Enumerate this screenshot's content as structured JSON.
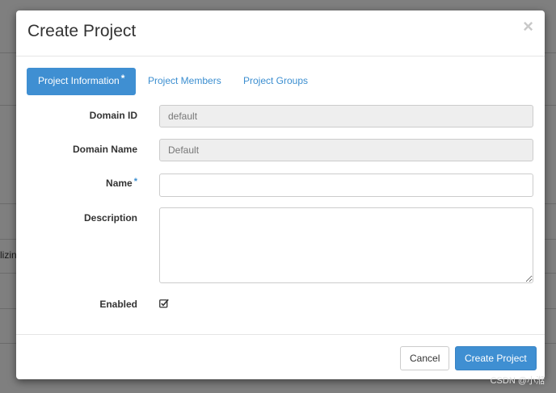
{
  "background": {
    "partial_text": "lizin"
  },
  "modal": {
    "title": "Create Project",
    "close_symbol": "×",
    "tabs": [
      {
        "label": "Project Information",
        "required_mark": "*",
        "active": true
      },
      {
        "label": "Project Members",
        "active": false
      },
      {
        "label": "Project Groups",
        "active": false
      }
    ],
    "form": {
      "domain_id": {
        "label": "Domain ID",
        "value": "default"
      },
      "domain_name": {
        "label": "Domain Name",
        "value": "Default"
      },
      "name": {
        "label": "Name",
        "required_mark": "*",
        "value": ""
      },
      "description": {
        "label": "Description",
        "value": ""
      },
      "enabled": {
        "label": "Enabled",
        "checked": true,
        "icon": "checked-checkbox-icon"
      }
    },
    "footer": {
      "cancel_label": "Cancel",
      "create_label": "Create Project"
    }
  },
  "watermark": "CSDN @小湉",
  "colors": {
    "accent": "#3f8fd2",
    "link": "#3b8ed0",
    "disabled_bg": "#eeeeee"
  }
}
